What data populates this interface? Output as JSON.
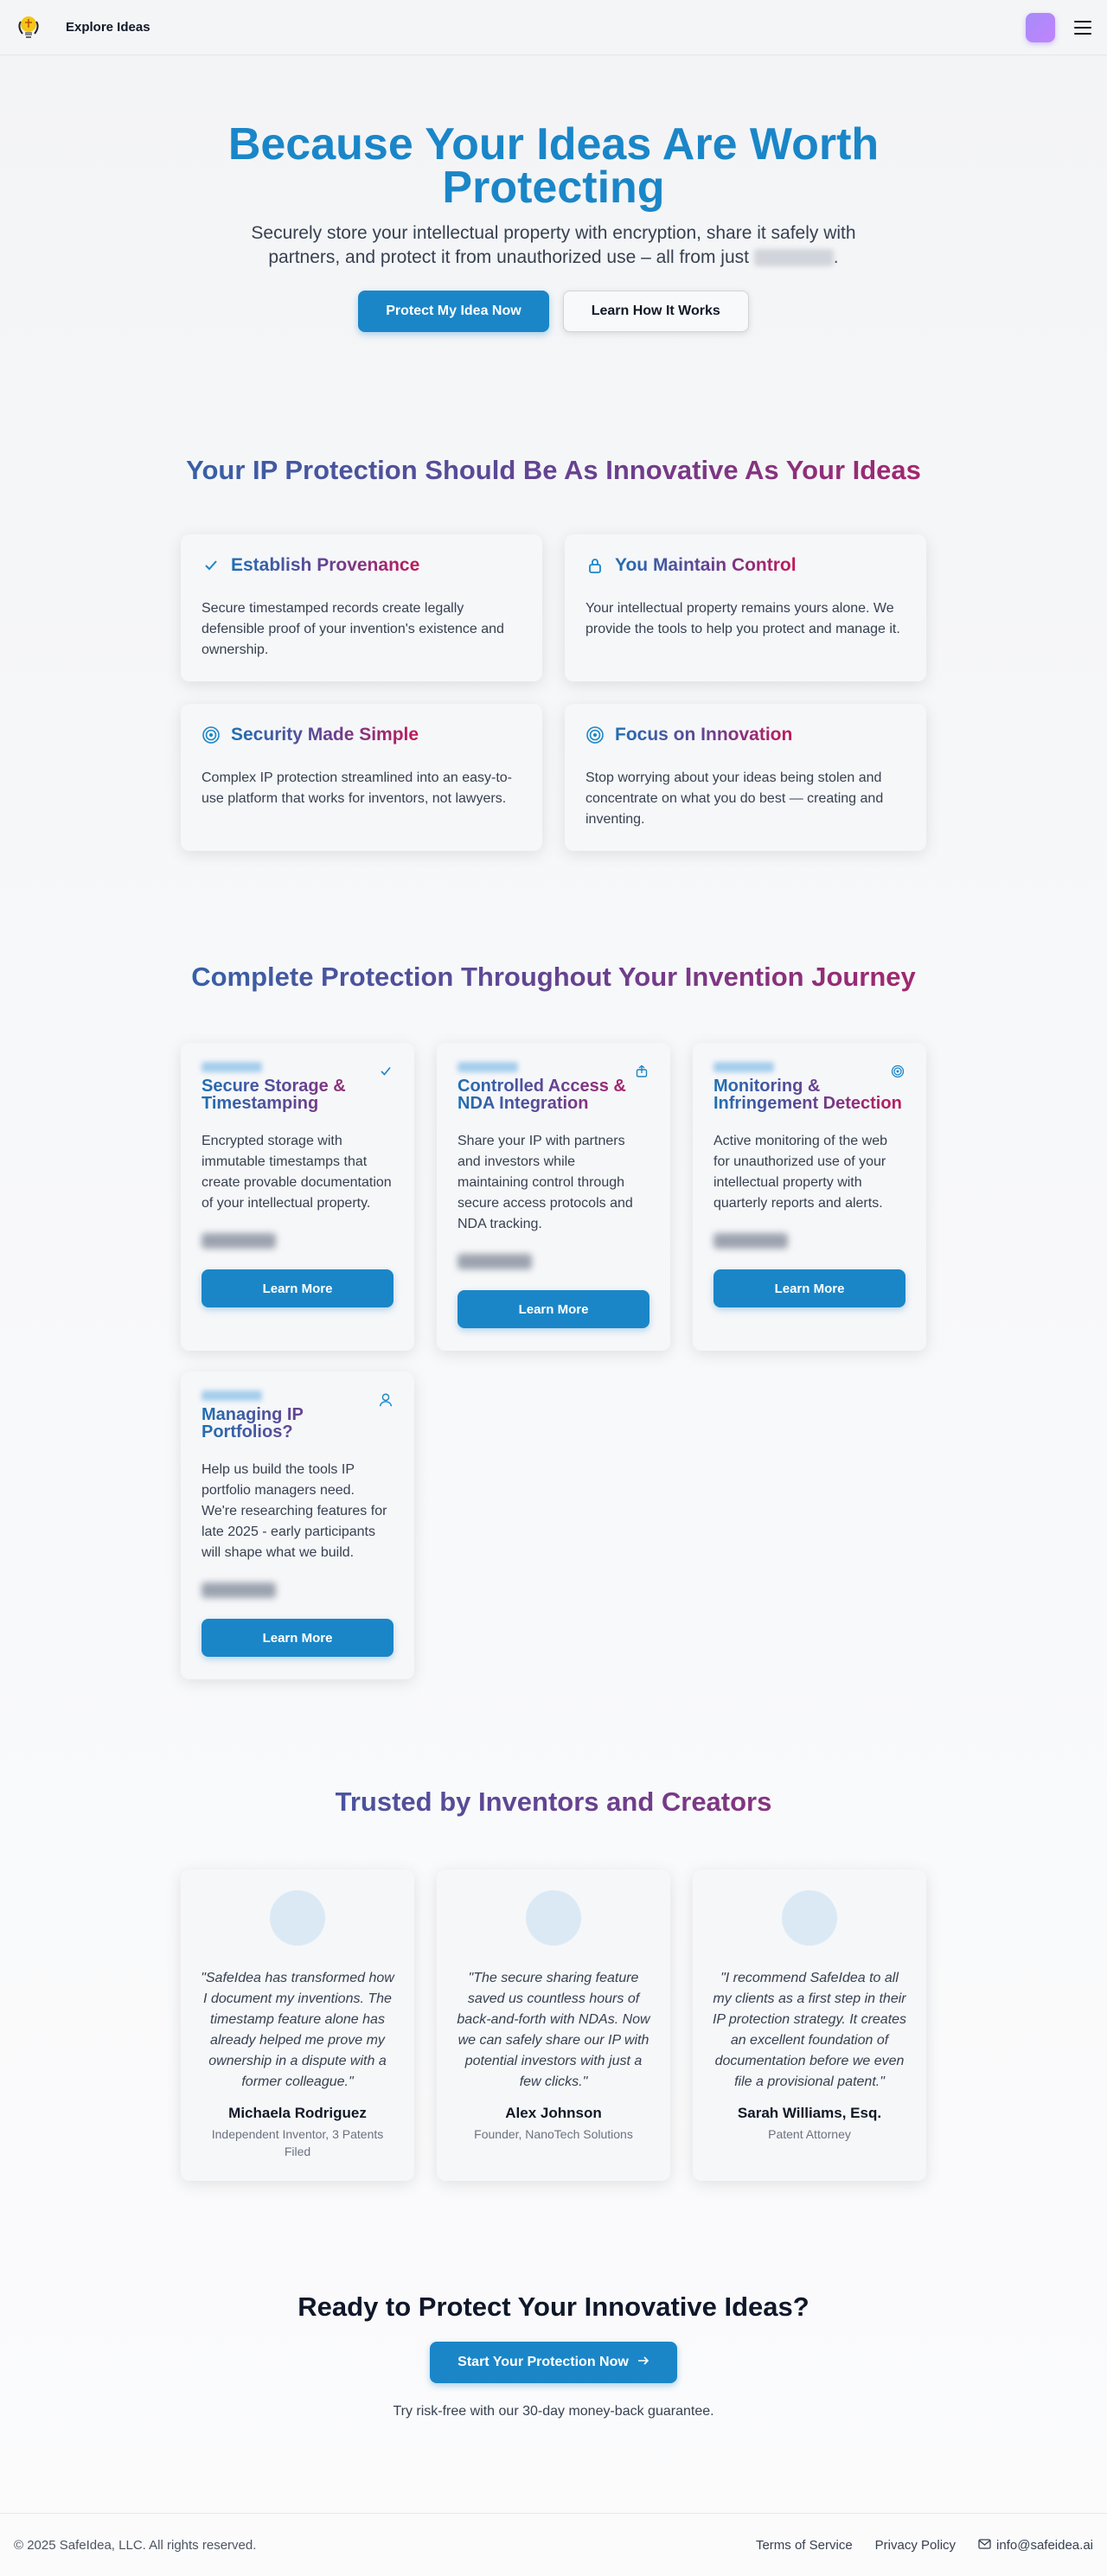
{
  "nav": {
    "explore_label": "Explore Ideas",
    "logo_icon": "lightbulb-shield-logo",
    "menu_icon": "hamburger-menu-icon"
  },
  "hero": {
    "title": "Because Your Ideas Are Worth Protecting",
    "subtitle": "Securely store your intellectual property with encryption, share it safely with partners, and protect it from unauthorized use – all from just",
    "subtitle_end": ".",
    "primary_button": "Protect My Idea Now",
    "secondary_button": "Learn How It Works"
  },
  "features": {
    "title": "Your IP Protection Should Be As Innovative As Your Ideas",
    "items": [
      {
        "title": "Establish Provenance",
        "icon": "check-icon",
        "text": "Secure timestamped records create legally defensible proof of your invention's existence and ownership."
      },
      {
        "title": "You Maintain Control",
        "icon": "lock-icon",
        "text": "Your intellectual property remains yours alone. We provide the tools to help you protect and manage it."
      },
      {
        "title": "Security Made Simple",
        "icon": "target-icon",
        "text": "Complex IP protection streamlined into an easy-to-use platform that works for inventors, not lawyers."
      },
      {
        "title": "Focus on Innovation",
        "icon": "target-icon",
        "text": "Stop worrying about your ideas being stolen and concentrate on what you do best — creating and inventing."
      }
    ]
  },
  "services": {
    "title": "Complete Protection Throughout Your Invention Journey",
    "button_label": "Learn More",
    "items": [
      {
        "title": "Secure Storage & Timestamping",
        "icon": "check-icon",
        "text": "Encrypted storage with immutable timestamps that create provable documentation of your intellectual property."
      },
      {
        "title": "Controlled Access & NDA Integration",
        "icon": "share-icon",
        "text": "Share your IP with partners and investors while maintaining control through secure access protocols and NDA tracking."
      },
      {
        "title": "Monitoring & Infringement Detection",
        "icon": "radar-icon",
        "text": "Active monitoring of the web for unauthorized use of your intellectual property with quarterly reports and alerts."
      },
      {
        "title": "Managing IP Portfolios?",
        "icon": "user-icon",
        "text": "Help us build the tools IP portfolio managers need. We're researching features for late 2025 - early participants will shape what we build."
      }
    ]
  },
  "testimonials": {
    "title": "Trusted by Inventors and Creators",
    "items": [
      {
        "quote": "\"SafeIdea has transformed how I document my inventions. The timestamp feature alone has already helped me prove my ownership in a dispute with a former colleague.\"",
        "name": "Michaela Rodriguez",
        "role": "Independent Inventor, 3 Patents Filed"
      },
      {
        "quote": "\"The secure sharing feature saved us countless hours of back-and-forth with NDAs. Now we can safely share our IP with potential investors with just a few clicks.\"",
        "name": "Alex Johnson",
        "role": "Founder, NanoTech Solutions"
      },
      {
        "quote": "\"I recommend SafeIdea to all my clients as a first step in their IP protection strategy. It creates an excellent foundation of documentation before we even file a provisional patent.\"",
        "name": "Sarah Williams, Esq.",
        "role": "Patent Attorney"
      }
    ]
  },
  "cta": {
    "title": "Ready to Protect Your Innovative Ideas?",
    "button": "Start Your Protection Now",
    "note": "Try risk-free with our 30-day money-back guarantee."
  },
  "footer": {
    "copyright": "© 2025 SafeIdea, LLC. All rights reserved.",
    "terms": "Terms of Service",
    "privacy": "Privacy Policy",
    "email": "info@safeidea.ai"
  },
  "colors": {
    "brand_blue": "#1a86c8",
    "gradient_start": "#1f6fb2",
    "gradient_mid": "#6b3f8e",
    "gradient_end": "#c2185b"
  }
}
